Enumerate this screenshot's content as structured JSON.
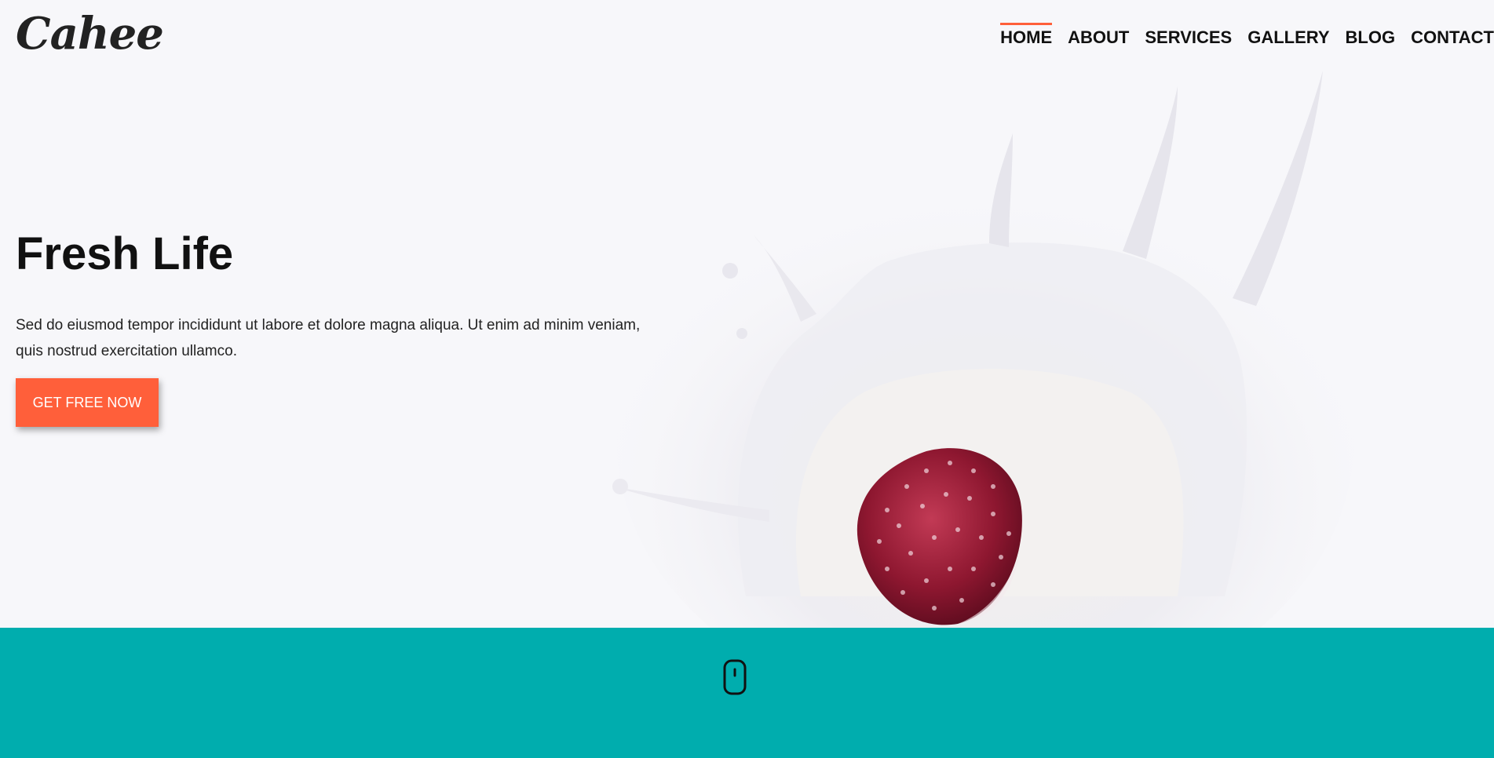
{
  "brand": {
    "logo_text": "Cahee"
  },
  "nav": {
    "items": [
      {
        "label": "HOME",
        "active": true
      },
      {
        "label": "ABOUT"
      },
      {
        "label": "SERVICES"
      },
      {
        "label": "GALLERY"
      },
      {
        "label": "BLOG"
      },
      {
        "label": "CONTACT"
      }
    ]
  },
  "hero": {
    "title": "Fresh Life",
    "text": "Sed do eiusmod tempor incididunt ut labore et dolore magna aliqua. Ut enim ad minim veniam, quis nostrud exercitation ullamco.",
    "cta_label": "GET FREE NOW"
  },
  "colors": {
    "accent": "#ff5f3a",
    "band": "#00adae",
    "hero_bg": "#f7f7fa"
  },
  "icons": {
    "scroll": "mouse-icon"
  }
}
